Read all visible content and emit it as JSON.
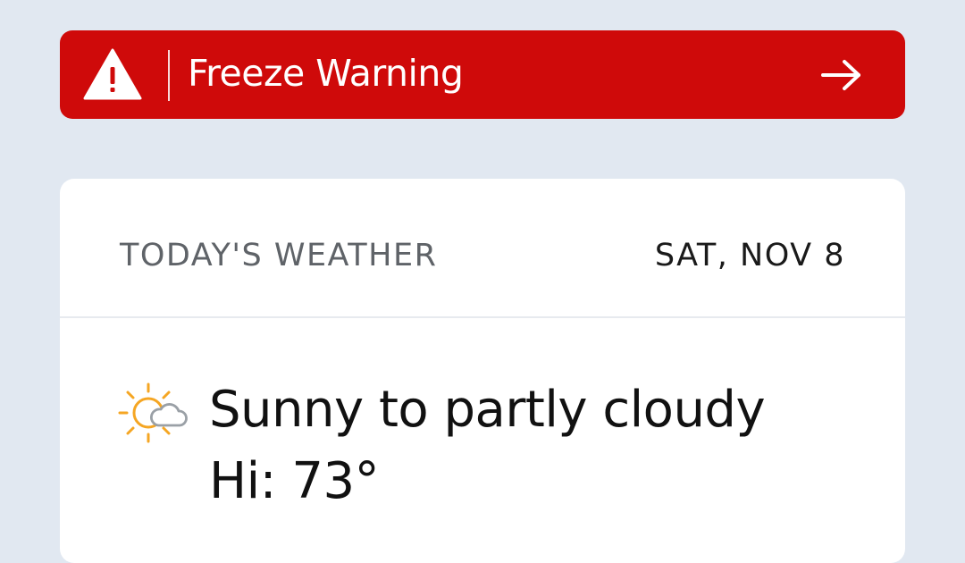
{
  "alert": {
    "title": "Freeze Warning",
    "icon": "warning-triangle-icon",
    "arrow_icon": "arrow-right-icon",
    "color": "#cf0a0a"
  },
  "weather": {
    "heading": "TODAY'S WEATHER",
    "date": "SAT, NOV 8",
    "condition": "Sunny to partly cloudy",
    "condition_icon": "sun-cloud-icon",
    "high": "Hi: 73°"
  },
  "colors": {
    "background": "#e1e8f1",
    "card": "#ffffff",
    "icon_accent": "#f5a623"
  }
}
